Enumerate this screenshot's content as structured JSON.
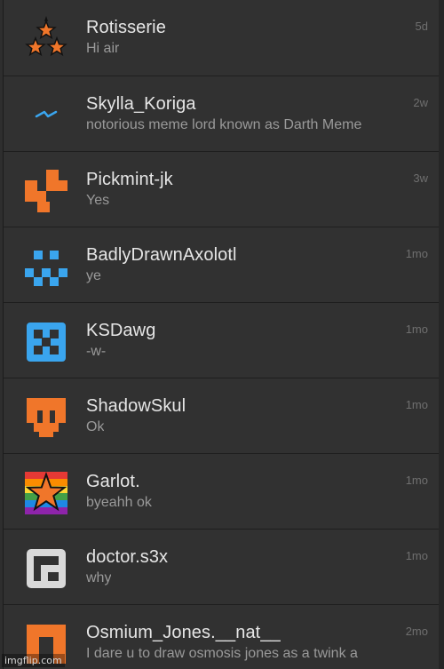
{
  "conversations": [
    {
      "name": "Rotisserie",
      "preview": "Hi air",
      "time": "5d",
      "avatar_icon": "three-stars-icon"
    },
    {
      "name": "Skylla_Koriga",
      "preview": "notorious meme lord known as Darth Meme",
      "time": "2w",
      "avatar_icon": "zigzag-icon"
    },
    {
      "name": "Pickmint-jk",
      "preview": "Yes",
      "time": "3w",
      "avatar_icon": "orange-identicon"
    },
    {
      "name": "BadlyDrawnAxolotl",
      "preview": "ye",
      "time": "1mo",
      "avatar_icon": "blue-face-identicon"
    },
    {
      "name": "KSDawg",
      "preview": "-w-",
      "time": "1mo",
      "avatar_icon": "blue-ring-identicon"
    },
    {
      "name": "ShadowSkul",
      "preview": "Ok",
      "time": "1mo",
      "avatar_icon": "orange-skull-identicon"
    },
    {
      "name": "Garlot.",
      "preview": "byeahh ok",
      "time": "1mo",
      "avatar_icon": "rainbow-star-icon"
    },
    {
      "name": "doctor.s3x",
      "preview": "why",
      "time": "1mo",
      "avatar_icon": "gray-identicon"
    },
    {
      "name": "Osmium_Jones.__nat__",
      "preview": "I dare u to draw osmosis jones as a twink a",
      "time": "2mo",
      "avatar_icon": "orange-arch-identicon"
    }
  ],
  "watermark": "imgflip.com",
  "colors": {
    "background": "#313131",
    "divider": "#1e1e1e",
    "name_text": "#e6e6e6",
    "preview_text": "#9a9a9a",
    "time_text": "#6f6f6f",
    "orange": "#f0762a",
    "blue": "#3aa5ee",
    "gray": "#d9d9d9"
  }
}
